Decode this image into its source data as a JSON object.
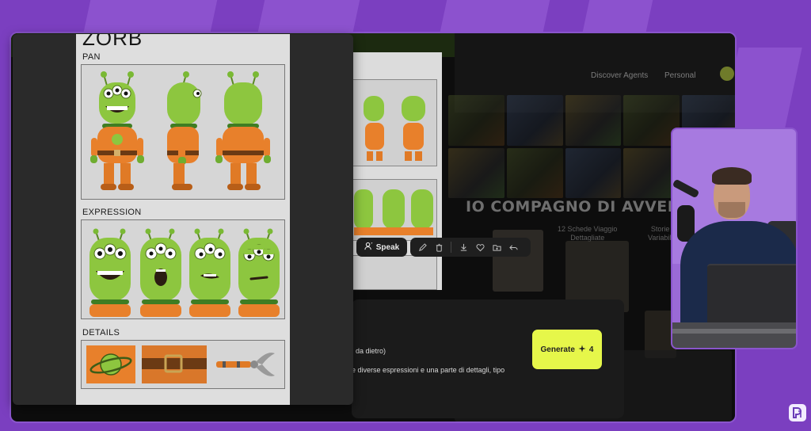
{
  "app_nav": {
    "links": [
      "Discover Agents",
      "Personal"
    ]
  },
  "page": {
    "headline": "IO COMPAGNO DI AVVENTURE",
    "sublabels": [
      "12 Schede Viaggio\nDettagliate",
      "Storie\nVariabili"
    ]
  },
  "character_sheet": {
    "title": "ZORB",
    "sections": [
      {
        "label": "PAN"
      },
      {
        "label": "EXPRESSION"
      },
      {
        "label": "DETAILS"
      }
    ]
  },
  "toolbar": {
    "speak_label": "Speak",
    "icons": [
      "edit-icon",
      "trash-icon",
      "download-icon",
      "heart-icon",
      "folder-icon",
      "share-icon"
    ]
  },
  "prompt": {
    "line1": ", da dietro)",
    "line2": "e diverse espressioni e una parte di dettagli, tipo"
  },
  "generate": {
    "label": "Generate",
    "count": "4"
  },
  "colors": {
    "background_purple": "#7b3fc0",
    "generate_yellow": "#e6f74a",
    "alien_green": "#8dc63f",
    "suit_orange": "#e8802b"
  }
}
